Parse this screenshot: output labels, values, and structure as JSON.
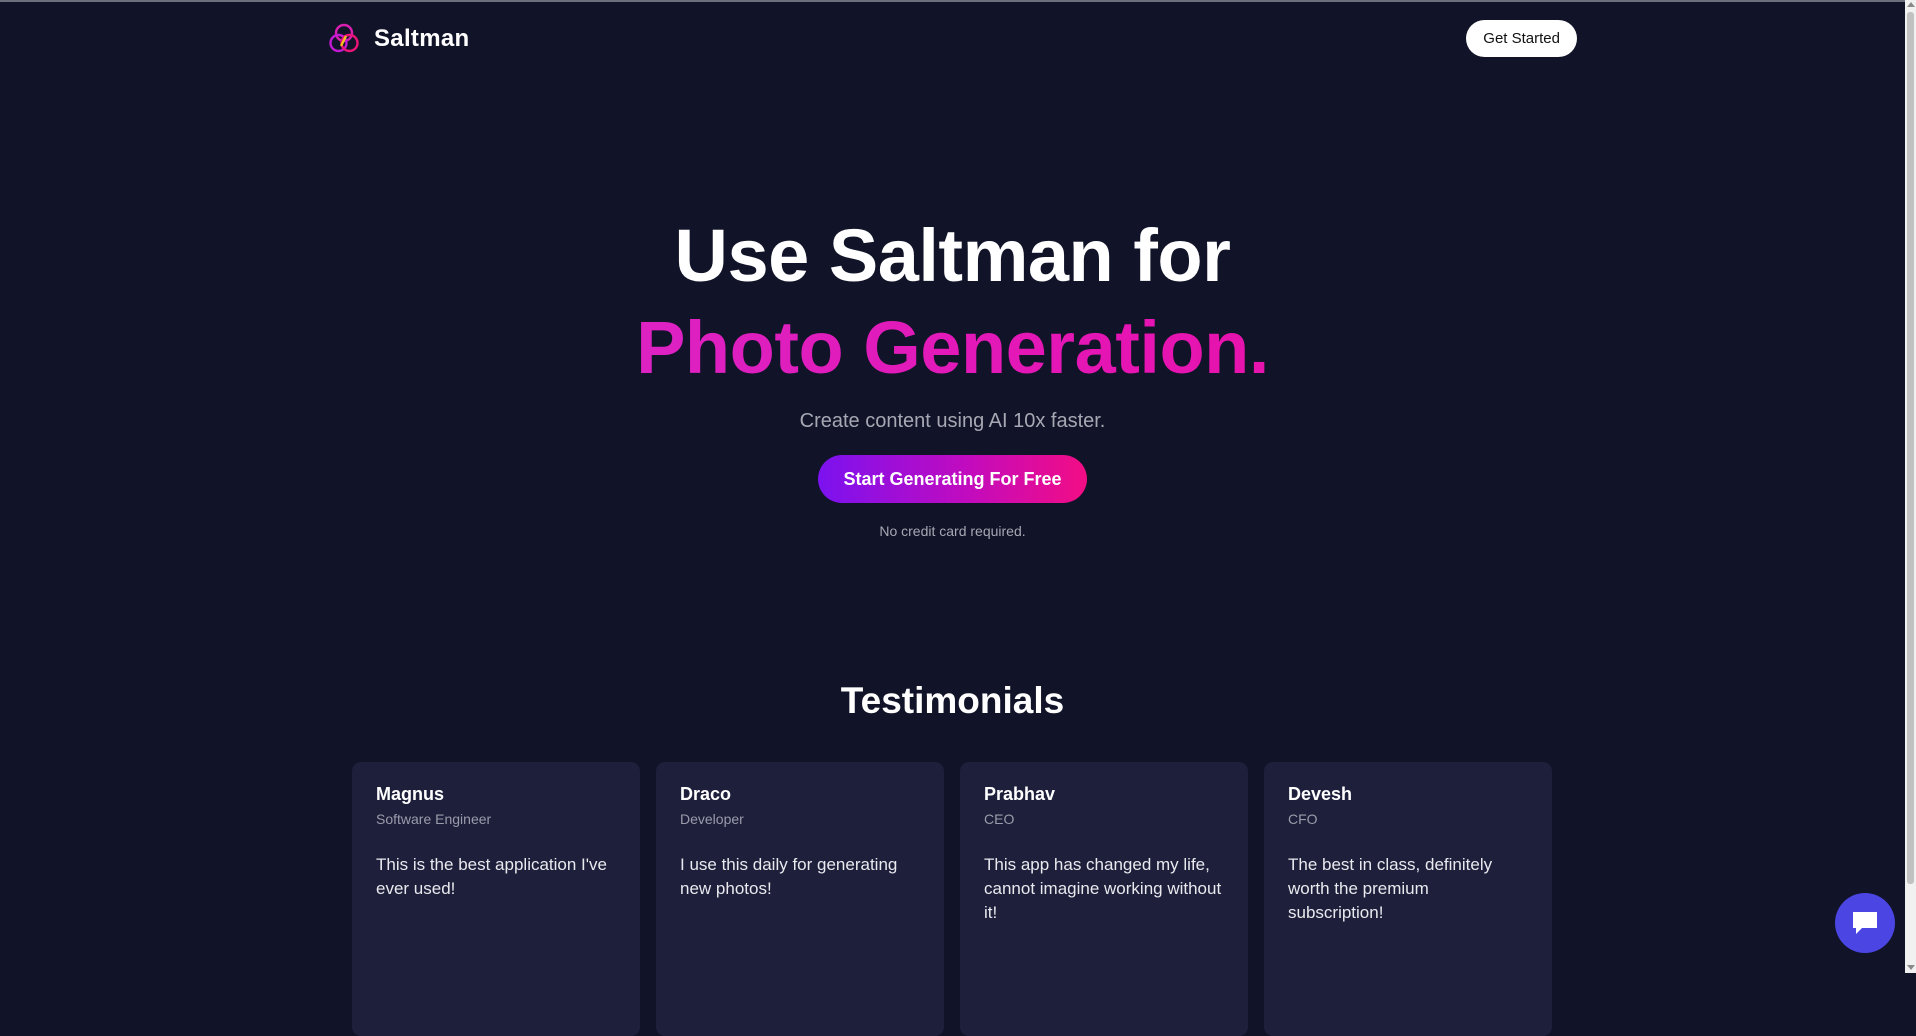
{
  "header": {
    "brand_name": "Saltman",
    "cta_label": "Get Started"
  },
  "hero": {
    "title_line1": "Use Saltman for",
    "title_line2": "Photo Generation.",
    "subtitle": "Create content using AI 10x faster.",
    "cta_label": "Start Generating For Free",
    "note": "No credit card required."
  },
  "testimonials": {
    "title": "Testimonials",
    "items": [
      {
        "name": "Magnus",
        "role": "Software Engineer",
        "text": "This is the best application I've ever used!"
      },
      {
        "name": "Draco",
        "role": "Developer",
        "text": "I use this daily for generating new photos!"
      },
      {
        "name": "Prabhav",
        "role": "CEO",
        "text": "This app has changed my life, cannot imagine working without it!"
      },
      {
        "name": "Devesh",
        "role": "CFO",
        "text": "The best in class, definitely worth the premium subscription!"
      }
    ]
  },
  "icons": {
    "logo": "three-circles-logo-icon",
    "chat": "chat-bubble-icon"
  },
  "colors": {
    "background": "#111328",
    "card_background": "#1d1f3b",
    "accent_gradient_start": "#7b12f0",
    "accent_gradient_end": "#f30d84",
    "headline_pink": "#e514b2",
    "chat_button": "#4b46e3"
  }
}
